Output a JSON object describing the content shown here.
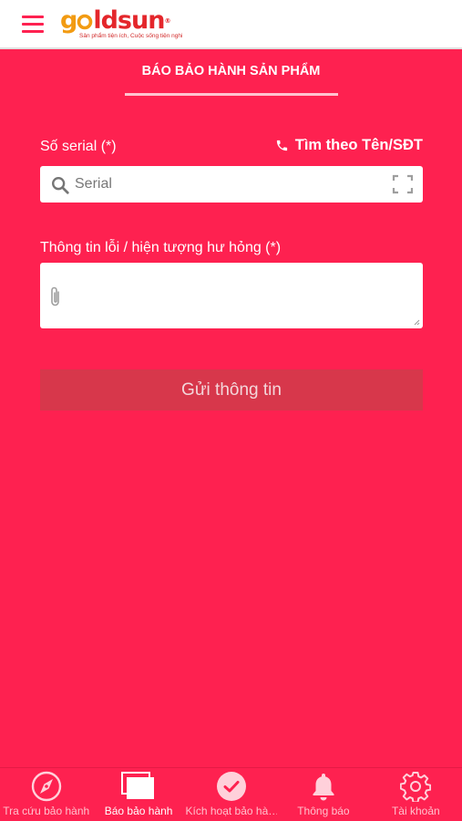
{
  "header": {
    "logo_text_part1": "g",
    "logo_text_part2": "ldsun",
    "logo_reg": "®",
    "logo_tagline": "Sản phẩm tiện ích, Cuộc sống tiện nghi"
  },
  "page": {
    "title": "BÁO BẢO HÀNH SẢN PHẨM"
  },
  "form": {
    "serial_label": "Số serial (*)",
    "search_by_label": "Tìm theo Tên/SĐT",
    "serial_placeholder": "Serial",
    "serial_value": "",
    "issue_label": "Thông tin lỗi / hiện tượng hư hỏng (*)",
    "issue_value": "",
    "submit_label": "Gửi thông tin"
  },
  "bottom_nav": {
    "items": [
      {
        "label": "Tra cứu bảo hành",
        "icon": "compass-icon",
        "active": false
      },
      {
        "label": "Báo bảo hành",
        "icon": "cards-icon",
        "active": true
      },
      {
        "label": "Kích hoạt bảo hà…",
        "icon": "check-circle-icon",
        "active": false
      },
      {
        "label": "Thông báo",
        "icon": "bell-icon",
        "active": false
      },
      {
        "label": "Tài khoản",
        "icon": "gear-icon",
        "active": false
      }
    ]
  },
  "colors": {
    "primary": "#fe2150",
    "logo_orange": "#f29b12",
    "logo_red": "#e4262b",
    "button": "#d7374b"
  }
}
